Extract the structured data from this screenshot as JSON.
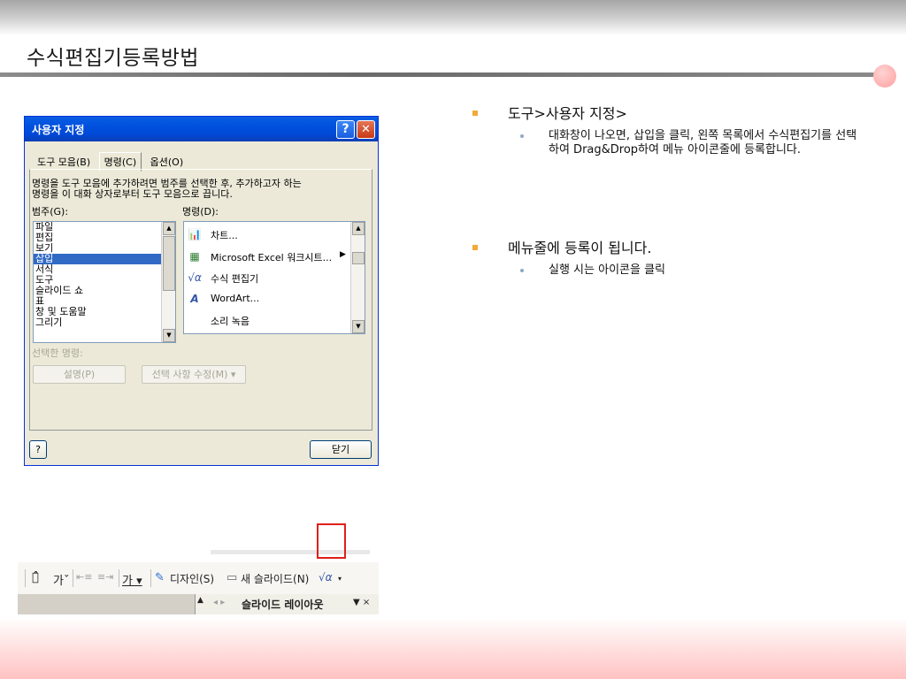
{
  "slide": {
    "title": "수식편집기등록방법"
  },
  "bullets": [
    {
      "text": "도구>사용자 지정>",
      "sub": [
        "대화창이 나오면, 삽입을 클릭, 왼쪽 목록에서 수식편집기를 선택하여 Drag&Drop하여 메뉴 아이콘줄에 등록합니다."
      ]
    },
    {
      "text": "메뉴줄에 등록이 됩니다.",
      "sub": [
        "실행 시는 아이콘을 클릭"
      ]
    }
  ],
  "dialog": {
    "title": "사용자 지정",
    "help_glyph": "?",
    "close_glyph": "✕",
    "tabs": [
      "도구 모음(B)",
      "명령(C)",
      "옵션(O)"
    ],
    "description_line1": "명령을 도구 모음에 추가하려면 범주를 선택한 후, 추가하고자 하는",
    "description_line2": "명령을 이 대화 상자로부터 도구 모음으로 끕니다.",
    "categories_label": "범주(G):",
    "commands_label": "명령(D):",
    "categories": [
      "파일",
      "편집",
      "보기",
      "삽입",
      "서식",
      "도구",
      "슬라이드 쇼",
      "표",
      "창 및 도움말",
      "그리기"
    ],
    "selected_category": "삽입",
    "commands": [
      {
        "icon": "chart-icon",
        "glyph": "📊",
        "label": "차트..."
      },
      {
        "icon": "excel-worksheet-icon",
        "glyph": "▦",
        "label": "Microsoft Excel 워크시트...",
        "submenu": "▶"
      },
      {
        "icon": "equation-icon",
        "glyph": "√α",
        "label": "수식 편집기"
      },
      {
        "icon": "wordart-icon",
        "glyph": "A",
        "label": "WordArt..."
      },
      {
        "icon": "sound-record-icon",
        "glyph": "",
        "label": "소리 녹음"
      }
    ],
    "selected_command_label": "선택한 명령:",
    "description_button": "설명(P)",
    "modify_selection_button": "선택 사항 수정(M) ▾",
    "help_button": "?",
    "close_button": "닫기"
  },
  "toolbar": {
    "font_grow": "가̂",
    "font_shrink": "가ˇ",
    "indent_less": "⇤≡",
    "indent_more": "≡⇥",
    "font_color": "가 ▾",
    "design_button": "디자인(S)",
    "new_slide_button": "새 슬라이드(N)",
    "equation_button": "√α",
    "equation_dropdown": "▾",
    "pane_title": "슬라이드 레이아웃",
    "pane_nav": "◂ ▸",
    "pane_menu": "▼ ×"
  },
  "colors": {
    "title_bar": "#0153df",
    "selection": "#316ac5",
    "bullet_marker": "#f2a93b",
    "highlight_box": "#e0201a",
    "bottom_band": "#ffc2c2"
  }
}
